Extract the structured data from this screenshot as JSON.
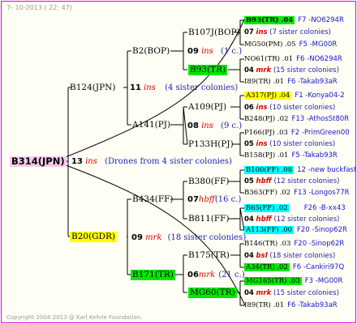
{
  "header": "7- 10-2013 ( 22: 47)",
  "footer": "Copyright 2004-2013 @ Karl Kehrle Foundation.",
  "root": {
    "name": "B314(JPN)",
    "num": "13",
    "sp": "ins",
    "comment": "(Drones from 4 sister colonies)"
  },
  "level1": [
    {
      "name": "B124(JPN)",
      "num": "11",
      "sp": "ins",
      "comment": "(4 sister colonies)"
    },
    {
      "name": "B20(GDR)",
      "num": "09",
      "sp": "mrk",
      "comment": "(18 sister colonies)"
    }
  ],
  "level2": [
    {
      "name": "B2(BOP)",
      "num": "09",
      "sp": "ins",
      "comment": "(1 c.)"
    },
    {
      "name": "A141(PJ)",
      "num": "08",
      "sp": "ins",
      "comment": "(9 c.)"
    },
    {
      "name": "B434(FF)",
      "num": "07",
      "sp": "hbff",
      "comment": "(16 c.)"
    },
    {
      "name": "B171(TR)",
      "num": "06",
      "sp": "mrk",
      "comment": "(21 c.)"
    }
  ],
  "level3": [
    "B107J(BOP)",
    "B93(TR)",
    "A109(PJ)",
    "P133H(PJ)",
    "B380(FF)",
    "B811(FF)",
    "B175(TR)",
    "MG60(TR)"
  ],
  "records": [
    {
      "a": "B93(TR) .04",
      "b": "F7 -NO6294R"
    },
    {
      "n": "07",
      "s": "ins",
      "c": "(7 sister colonies)"
    },
    {
      "a": "MG50(PM) .05",
      "b": "F5 -MG00R"
    },
    {
      "a": "NO61(TR) .01",
      "b": "F6 -NO6294R"
    },
    {
      "n": "04",
      "s": "mrk",
      "c": "(15 sister colonies)"
    },
    {
      "a": "I89(TR) .01",
      "b": "F6 -Takab93aR"
    },
    {
      "a": "A317(PJ) .04",
      "b": "F1 -Konya04-2"
    },
    {
      "n": "06",
      "s": "ins",
      "c": "(10 sister colonies)"
    },
    {
      "a": "B248(PJ) .02",
      "b": "F13 -AthosSt80R"
    },
    {
      "a": "P166(PJ) .03",
      "b": "F2 -PrimGreen00"
    },
    {
      "n": "05",
      "s": "ins",
      "c": "(10 sister colonies)"
    },
    {
      "a": "B158(PJ) .01",
      "b": "F5 -Takab93R"
    },
    {
      "a": "B100(FF) .08",
      "b": "12 -new buckfast"
    },
    {
      "n": "05",
      "s": "hbff",
      "c": "(12 sister colonies)"
    },
    {
      "a": "B363(FF) .02",
      "b": "F13 -Longos77R"
    },
    {
      "a": "B65(FF) .02",
      "b": "F26 -B-xx43"
    },
    {
      "n": "04",
      "s": "hbff",
      "c": "(12 sister colonies)"
    },
    {
      "a": "A113(FF) .00",
      "b": "F20 -Sinop62R"
    },
    {
      "a": "B146(TR) .03",
      "b": "F20 -Sinop62R"
    },
    {
      "n": "04",
      "s": "bsl",
      "c": "(18 sister colonies)"
    },
    {
      "a": "A34(TR) .02",
      "b": "F6 -Cankiri97Q"
    },
    {
      "a": "MG165(TR) .03",
      "b": "F3 -MG00R"
    },
    {
      "n": "04",
      "s": "mrk",
      "c": "(15 sister colonies)"
    },
    {
      "a": "I89(TR) .01",
      "b": "F6 -Takab93aR"
    }
  ],
  "colors": {
    "border": "#e000e0",
    "root_bg": "#f7c8ee",
    "yellow": "#ffff00",
    "green": "#00e800",
    "cyan": "#00ffff",
    "species": "#e00000",
    "comment": "#2222aa"
  }
}
